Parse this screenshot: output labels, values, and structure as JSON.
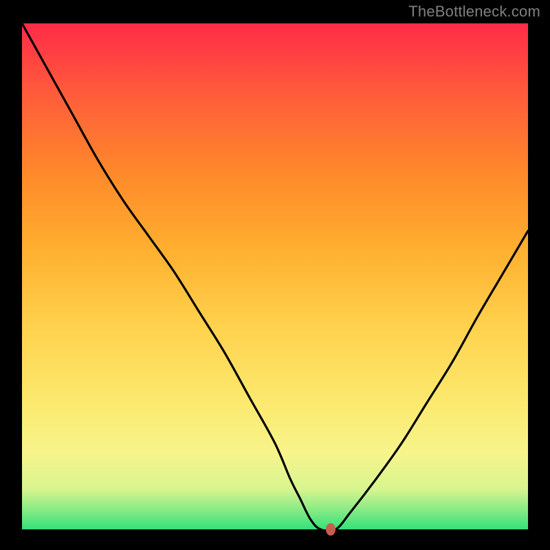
{
  "watermark": "TheBottleneck.com",
  "colors": {
    "background": "#000000",
    "gradient_top": "#ff2b48",
    "gradient_bottom": "#33e27a",
    "curve": "#000000",
    "marker": "#c65e50",
    "watermark_text": "#808080"
  },
  "chart_data": {
    "type": "line",
    "title": "",
    "xlabel": "",
    "ylabel": "",
    "xlim": [
      0,
      100
    ],
    "ylim": [
      0,
      100
    ],
    "grid": false,
    "legend": false,
    "series": [
      {
        "name": "bottleneck-curve",
        "x": [
          0,
          5,
          10,
          15,
          20,
          25,
          30,
          35,
          40,
          45,
          50,
          53,
          55,
          57,
          59,
          62,
          65,
          70,
          75,
          80,
          85,
          90,
          95,
          100
        ],
        "values": [
          100,
          91,
          82,
          73,
          65,
          58,
          51,
          43,
          35,
          26,
          17,
          10,
          6,
          2,
          0,
          0,
          3.5,
          10,
          17,
          25,
          33,
          42,
          50.5,
          59
        ]
      }
    ],
    "annotations": [
      {
        "name": "minimum-marker",
        "x": 61,
        "y": 0
      }
    ]
  }
}
